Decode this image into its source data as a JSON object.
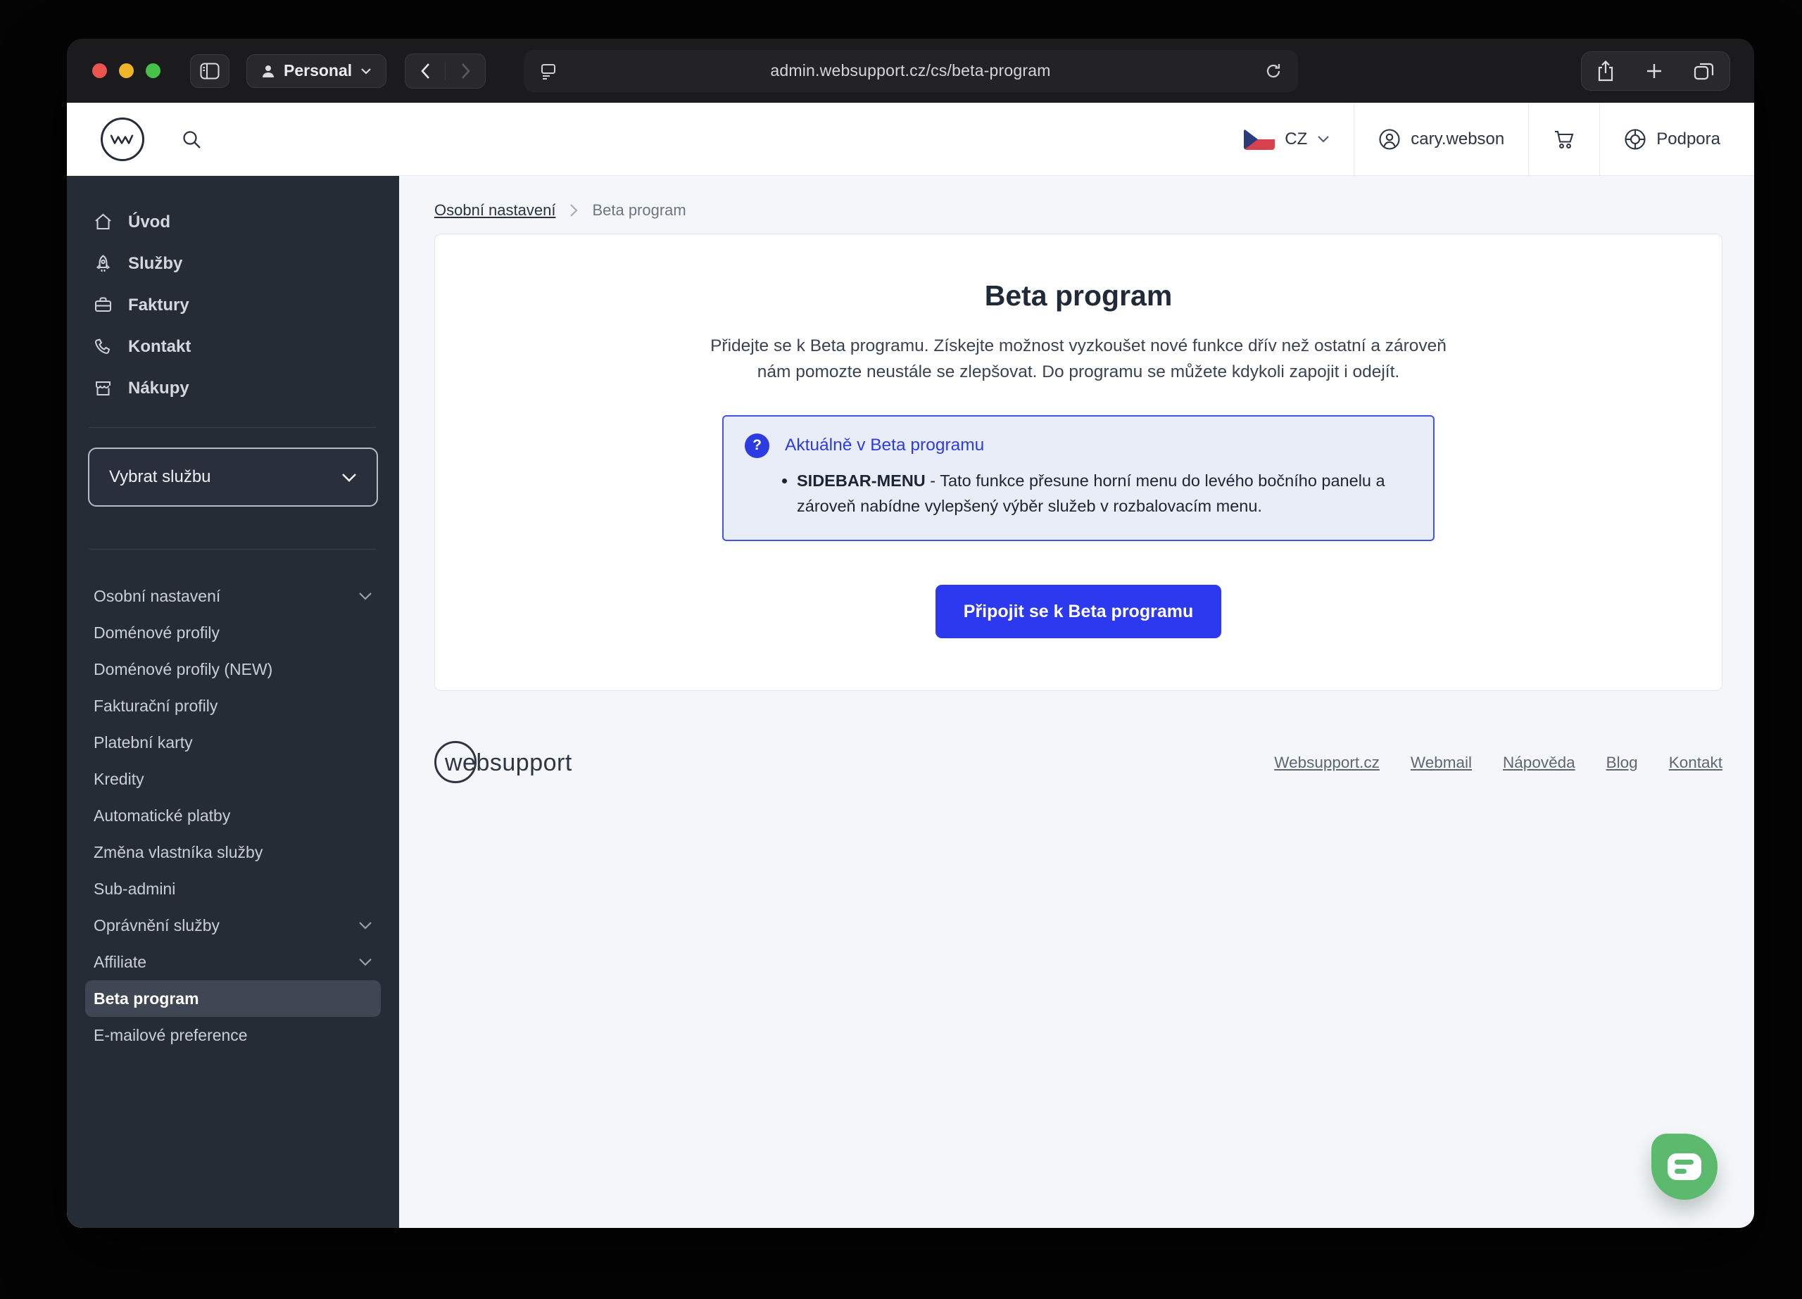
{
  "browser": {
    "profile_label": "Personal",
    "url": "admin.websupport.cz/cs/beta-program",
    "icons": [
      "sidebar-toggle-icon",
      "person-icon",
      "chevron-down-icon",
      "back-icon",
      "forward-icon",
      "reader-icon",
      "reload-icon",
      "share-icon",
      "new-tab-icon",
      "tabs-overview-icon"
    ],
    "traffic_lights": {
      "close": "#ec554f",
      "minimize": "#f0b429",
      "zoom": "#44c249"
    }
  },
  "topbar": {
    "logo": "websupport-logo",
    "search_icon": "search-icon",
    "language": {
      "code": "CZ",
      "flag": "czech-flag-icon"
    },
    "username": "cary.webson",
    "cart_icon": "cart-icon",
    "support": {
      "label": "Podpora",
      "icon": "globe-icon"
    }
  },
  "sidebar": {
    "main_items": [
      {
        "label": "Úvod",
        "icon": "home-icon"
      },
      {
        "label": "Služby",
        "icon": "rocket-icon"
      },
      {
        "label": "Faktury",
        "icon": "briefcase-icon"
      },
      {
        "label": "Kontakt",
        "icon": "phone-icon"
      },
      {
        "label": "Nákupy",
        "icon": "store-icon"
      }
    ],
    "service_select": {
      "label": "Vybrat službu",
      "icon": "chevron-down-icon"
    },
    "settings": [
      {
        "label": "Osobní nastavení",
        "type": "header",
        "expanded": true
      },
      {
        "label": "Doménové profily",
        "type": "item"
      },
      {
        "label": "Doménové profily (NEW)",
        "type": "item"
      },
      {
        "label": "Fakturační profily",
        "type": "item"
      },
      {
        "label": "Platební karty",
        "type": "item"
      },
      {
        "label": "Kredity",
        "type": "item"
      },
      {
        "label": "Automatické platby",
        "type": "item"
      },
      {
        "label": "Změna vlastníka služby",
        "type": "item"
      },
      {
        "label": "Sub-admini",
        "type": "item"
      },
      {
        "label": "Oprávnění služby",
        "type": "group",
        "expanded": false
      },
      {
        "label": "Affiliate",
        "type": "group",
        "expanded": false
      },
      {
        "label": "Beta program",
        "type": "item",
        "selected": true
      },
      {
        "label": "E-mailové preference",
        "type": "item"
      }
    ]
  },
  "breadcrumb": {
    "parent": "Osobní nastavení",
    "current": "Beta program"
  },
  "main": {
    "title": "Beta program",
    "description": "Přidejte se k Beta programu. Získejte možnost vyzkoušet nové funkce dřív než ostatní a zároveň nám pomozte neustále se zlepšovat. Do programu se můžete kdykoli zapojit i odejít.",
    "info_box": {
      "icon": "question-circle-icon",
      "title": "Aktuálně v Beta programu",
      "bullet_bold": "SIDEBAR-MENU",
      "bullet_text": " - Tato funkce přesune horní menu do levého bočního panelu a zároveň nabídne vylepšený výběr služeb v rozbalovacím menu."
    },
    "join_button": "Připojit se k Beta programu"
  },
  "footer": {
    "logo_text": "websupport",
    "links": [
      "Websupport.cz",
      "Webmail",
      "Nápověda",
      "Blog",
      "Kontakt"
    ]
  },
  "chat_widget": {
    "icon": "chat-bubble-icon",
    "color": "#5bba6e"
  },
  "colors": {
    "accent_blue": "#2c39ee",
    "info_border": "#4355e8",
    "info_background": "#e9edf8",
    "sidebar_background": "#262c36",
    "sidebar_selected": "#3f4654",
    "page_background": "#f4f6f9",
    "chat_green": "#5bba6e"
  }
}
